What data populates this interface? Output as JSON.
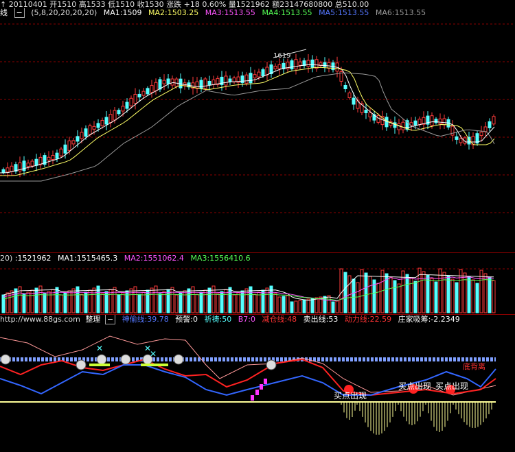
{
  "colors": {
    "up": "#ff3b3b",
    "down": "#54ffff",
    "ma1": "#ffffff",
    "ma2": "#ffff66",
    "ma3": "#ff55ff",
    "ma4": "#55ff55",
    "ma5": "#5577ff",
    "ma6": "#9a9a9a",
    "grid": "#8b0000",
    "axis": "#c0c0c0"
  },
  "top_bar": {
    "text": "↑ 20110401 开1510 高1533 低1510 收1530 涨跌 +18 0.60% 量1521962 额23147680800 总510.00"
  },
  "ma_bar": {
    "prefix": "线",
    "params": "(5,8,20,20,20,20)",
    "ma1": "MA1:1509",
    "ma2": "MA2:1503.25",
    "ma3": "MA3:1513.55",
    "ma4": "MA4:1513.55",
    "ma5": "MA5:1513.55",
    "ma6": "MA6:1513.55"
  },
  "price_panel": {
    "peak_label": "1619"
  },
  "vol_bar": {
    "prefix": "20)",
    "value": ":1521962",
    "ma1": "MA1:1515465.3",
    "ma2": "MA2:1551062.4",
    "ma3": "MA3:1556410.6"
  },
  "ind_bar": {
    "url": "http://www.88gs.com",
    "menu": "整理",
    "shenlun": "神偷线:39.78",
    "yujing": "预警:0",
    "qidao": "祈祷:50",
    "b7": "B7:0",
    "jiancang": "减仓线:48",
    "maichu": "卖出线:53",
    "dongli": "动力线:22.59",
    "zhuangjia": "庄家吸筹:-2.2349"
  },
  "annotations": {
    "buy1": "买点出现",
    "buy2": "买点出现",
    "buy3": "买点出现",
    "top": "底背离"
  }
}
